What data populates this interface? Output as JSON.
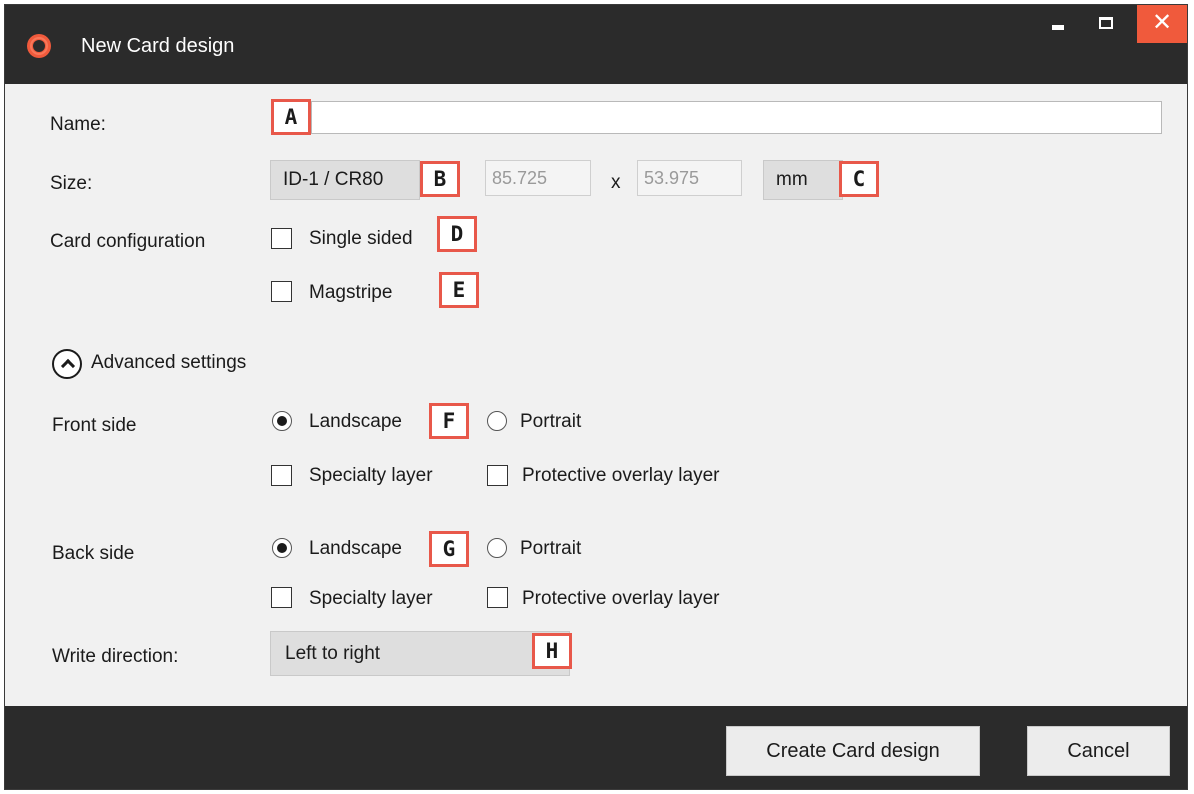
{
  "window": {
    "title": "New Card design",
    "close_glyph": "✕",
    "icons": [
      "app-logo-icon",
      "minimize-icon",
      "maximize-icon",
      "close-icon"
    ],
    "accent_color": "#f05a3c"
  },
  "form": {
    "name_label": "Name:",
    "name_value": "",
    "size_label": "Size:",
    "size_preset": "ID-1 / CR80",
    "width_value": "85.725",
    "times": "x",
    "height_value": "53.975",
    "unit": "mm",
    "card_config_label": "Card configuration",
    "single_sided_label": "Single sided",
    "single_sided_checked": false,
    "magstripe_label": "Magstripe",
    "magstripe_checked": false
  },
  "advanced": {
    "toggle_label": "Advanced settings",
    "toggle_icon": "chevron-up-circle-icon",
    "front": {
      "label": "Front side",
      "landscape_label": "Landscape",
      "portrait_label": "Portrait",
      "orientation": "Landscape",
      "specialty_label": "Specialty layer",
      "protective_label": "Protective overlay layer"
    },
    "back": {
      "label": "Back side",
      "landscape_label": "Landscape",
      "portrait_label": "Portrait",
      "orientation": "Landscape",
      "specialty_label": "Specialty layer",
      "protective_label": "Protective overlay layer"
    },
    "write_direction_label": "Write direction:",
    "write_direction_value": "Left to right"
  },
  "markers": {
    "a": "A",
    "b": "B",
    "c": "C",
    "d": "D",
    "e": "E",
    "f": "F",
    "g": "G",
    "h": "H",
    "color": "#e8584a"
  },
  "footer": {
    "create_label": "Create Card design",
    "cancel_label": "Cancel"
  }
}
